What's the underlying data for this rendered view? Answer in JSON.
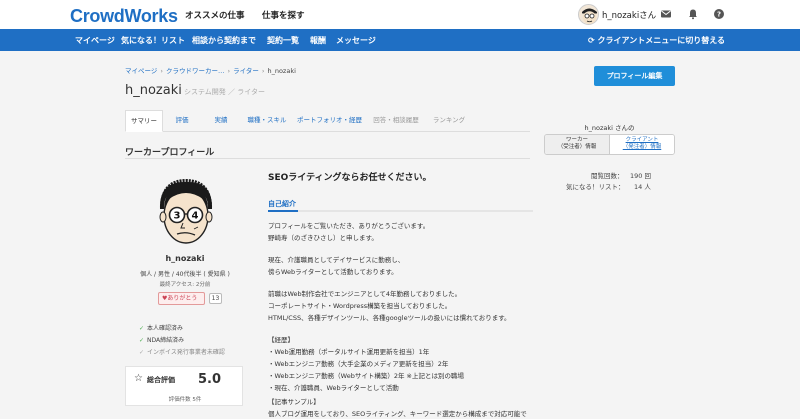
{
  "header": {
    "logo": "CrowdWorks",
    "nav": [
      "オススメの仕事",
      "仕事を探す"
    ],
    "username": "h_nozakiさん",
    "icons": [
      "mail-icon",
      "bell-icon",
      "help-icon"
    ]
  },
  "bluebar": {
    "items": [
      "マイページ",
      "気になる！リスト",
      "相談から契約まで",
      "契約一覧",
      "報酬",
      "メッセージ"
    ],
    "switch_label": "クライアントメニューに切り替える"
  },
  "breadcrumb": [
    "マイページ",
    "クラウドワーカー…",
    "ライター",
    "h_nozaki"
  ],
  "profile_edit_label": "プロフィール編集",
  "profile": {
    "name": "h_nozaki",
    "sub": "システム開発 ／ ライター",
    "tabs": [
      "サマリー",
      "評価",
      "実績",
      "職種・スキル",
      "ポートフォリオ・経歴",
      "回答・相談履歴",
      "ランキング"
    ],
    "section_title": "ワーカープロフィール",
    "username": "h_nozaki",
    "info": "個人 / 男性 / 40代後半 ( 愛知県 )",
    "last_access": "最終アクセス: 2分前",
    "thanks_label": "ありがとう",
    "thanks_count": "13",
    "verifications": [
      "本人確認済み",
      "NDA締結済み",
      "インボイス発行事業者未確認"
    ],
    "rating_label": "総合評価",
    "rating_value": "5.0",
    "rating_count": "評価件数 5件",
    "avatar_numbers": [
      "3",
      "4"
    ]
  },
  "main": {
    "headline": "SEOライティングならお任せください。",
    "intro_tab": "自己紹介",
    "lines": [
      "プロフィールをご覧いただき、ありがとうございます。",
      "野崎寿（のざきひさし）と申します。",
      "",
      "現在、介護職員としてデイサービスに勤務し、",
      "傍らWebライターとして活動しております。",
      "",
      "前職はWeb制作会社でエンジニアとして4年勤務しておりました。",
      "コーポレートサイト・Wordpress構築を担当しておりました。",
      "HTML/CSS、各種デザインツール、各種googleツールの扱いには慣れております。",
      "",
      "【経歴】",
      "・Web運用勤務（ポータルサイト運用更新を担当）1年",
      "・Webエンジニア勤務（大手企業のメディア更新を担当）2年",
      "・Webエンジニア勤務（Webサイト構築）2年 ※上記とは別の職場",
      "・現在、介護職員、Webライターとして活動",
      "",
      "【記事サンプル】",
      "個人ブログ運用をしており、SEOライティング、キーワード選定から構成まで対応可能で"
    ]
  },
  "sidebar": {
    "title": "h_nozaki さんの",
    "seg_worker": [
      "ワーカー",
      "（受注者）情報"
    ],
    "seg_client": [
      "クライアント",
      "（発注者）情報"
    ],
    "views_label": "閲覧回数：",
    "views_value": "190 回",
    "fav_label": "気になる！リスト：",
    "fav_value": "14 人"
  }
}
